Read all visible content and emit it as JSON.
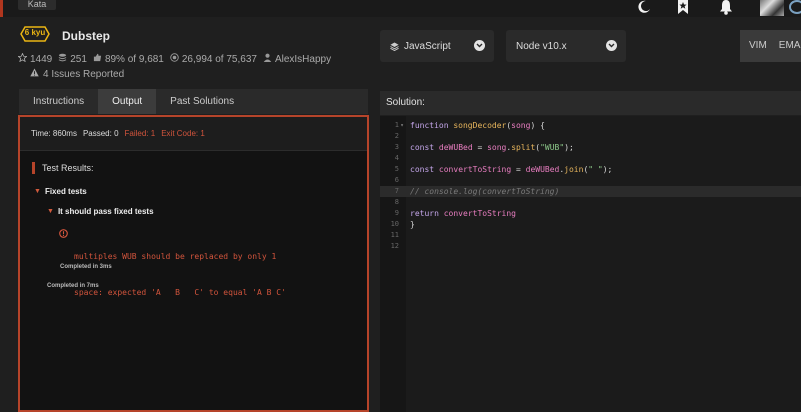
{
  "topbar": {
    "tab_label": "Kata",
    "icons": [
      "moon-icon",
      "bookmark-icon",
      "bell-icon",
      "avatar"
    ]
  },
  "kata": {
    "rank": "6 kyu",
    "title": "Dubstep",
    "votes": "1449",
    "collections": "251",
    "satisfaction": "89% of 9,681",
    "completions": "26,994 of 75,637",
    "author": "AlexIsHappy",
    "issues": "4 Issues Reported"
  },
  "toolbar": {
    "language": "JavaScript",
    "runtime": "Node v10.x",
    "vim_label": "VIM",
    "emacs_label": "EMA"
  },
  "tabs": [
    "Instructions",
    "Output",
    "Past Solutions"
  ],
  "output": {
    "time": "Time: 860ms",
    "passed": "Passed: 0",
    "failed": "Failed: 1",
    "exit_code": "Exit Code: 1",
    "test_results_label": "Test Results:",
    "group": "Fixed tests",
    "subgroup": "It should pass fixed tests",
    "failure_line1": "multiples WUB should be replaced by only 1",
    "failure_line2": "space: expected 'A   B   C' to equal 'A B C'",
    "completed_inner": "Completed in 3ms",
    "completed_outer": "Completed in 7ms"
  },
  "solution": {
    "header": "Solution:",
    "line_numbers": [
      "1",
      "2",
      "3",
      "4",
      "5",
      "6",
      "7",
      "8",
      "9",
      "10",
      "11",
      "12"
    ]
  },
  "colors": {
    "accent_red": "#b6442a",
    "rank_yellow": "#ecb613"
  }
}
